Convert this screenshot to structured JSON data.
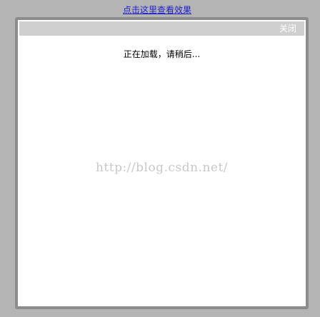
{
  "top_link": {
    "label": "点击这里查看效果"
  },
  "dialog": {
    "close_label": "关闭",
    "loading_text": "正在加载，请稍后...",
    "watermark_text": "http://blog.csdn.net/"
  },
  "colors": {
    "backdrop": "#b4b4b4",
    "dialog_border": "#8c8c8c",
    "titlebar": "#cfcfcf",
    "link": "#2020c8"
  }
}
